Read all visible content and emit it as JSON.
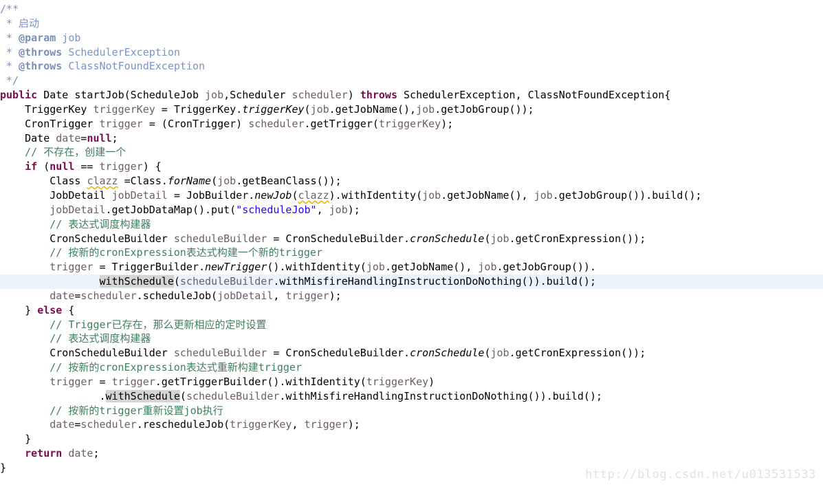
{
  "editor": {
    "language": "java",
    "background": "#ffffff",
    "current_line_highlight_color": "#eaf2fc",
    "occurrence_highlight_color": "#d4d4d4",
    "colors": {
      "keyword": "#7a0d4d",
      "comment": "#3f7f5f",
      "javadoc": "#7a93c4",
      "javadoc_tag": "#7a8fb8",
      "string": "#2a00ff",
      "variable": "#6e5c6b",
      "plain": "#000000",
      "warning_squiggle": "#e8b000"
    },
    "caret_line_index": 20,
    "lines": [
      {
        "i": 0,
        "text": "/**"
      },
      {
        "i": 1,
        "text": " * 启动"
      },
      {
        "i": 2,
        "text": " * @param job"
      },
      {
        "i": 3,
        "text": " * @throws SchedulerException"
      },
      {
        "i": 4,
        "text": " * @throws ClassNotFoundException"
      },
      {
        "i": 5,
        "text": " */"
      },
      {
        "i": 6,
        "text": "public Date startJob(ScheduleJob job,Scheduler scheduler) throws SchedulerException, ClassNotFoundException{"
      },
      {
        "i": 7,
        "text": "    TriggerKey triggerKey = TriggerKey.triggerKey(job.getJobName(),job.getJobGroup());"
      },
      {
        "i": 8,
        "text": "    CronTrigger trigger = (CronTrigger) scheduler.getTrigger(triggerKey);"
      },
      {
        "i": 9,
        "text": "    Date date=null;"
      },
      {
        "i": 10,
        "text": "    // 不存在，创建一个"
      },
      {
        "i": 11,
        "text": "    if (null == trigger) {"
      },
      {
        "i": 12,
        "text": "        Class clazz =Class.forName(job.getBeanClass());"
      },
      {
        "i": 13,
        "text": "        JobDetail jobDetail = JobBuilder.newJob(clazz).withIdentity(job.getJobName(), job.getJobGroup()).build();"
      },
      {
        "i": 14,
        "text": "        jobDetail.getJobDataMap().put(\"scheduleJob\", job);"
      },
      {
        "i": 15,
        "text": "        // 表达式调度构建器"
      },
      {
        "i": 16,
        "text": "        CronScheduleBuilder scheduleBuilder = CronScheduleBuilder.cronSchedule(job.getCronExpression());"
      },
      {
        "i": 17,
        "text": "        // 按新的cronExpression表达式构建一个新的trigger"
      },
      {
        "i": 18,
        "text": "        trigger = TriggerBuilder.newTrigger().withIdentity(job.getJobName(), job.getJobGroup())."
      },
      {
        "i": 19,
        "text": "                withSchedule(scheduleBuilder.withMisfireHandlingInstructionDoNothing()).build();"
      },
      {
        "i": 20,
        "text": "        date=scheduler.scheduleJob(jobDetail, trigger);"
      },
      {
        "i": 21,
        "text": "    } else {"
      },
      {
        "i": 22,
        "text": "        // Trigger已存在，那么更新相应的定时设置"
      },
      {
        "i": 23,
        "text": "        // 表达式调度构建器"
      },
      {
        "i": 24,
        "text": "        CronScheduleBuilder scheduleBuilder = CronScheduleBuilder.cronSchedule(job.getCronExpression());"
      },
      {
        "i": 25,
        "text": "        // 按新的cronExpression表达式重新构建trigger"
      },
      {
        "i": 26,
        "text": "        trigger = trigger.getTriggerBuilder().withIdentity(triggerKey)"
      },
      {
        "i": 27,
        "text": "                .withSchedule(scheduleBuilder.withMisfireHandlingInstructionDoNothing()).build();"
      },
      {
        "i": 28,
        "text": "        // 按新的trigger重新设置job执行"
      },
      {
        "i": 29,
        "text": "        date=scheduler.rescheduleJob(triggerKey, trigger);"
      },
      {
        "i": 30,
        "text": "    }"
      },
      {
        "i": 31,
        "text": "    return date;"
      },
      {
        "i": 32,
        "text": "}"
      }
    ],
    "tokens": {
      "keywords": [
        "public",
        "throws",
        "if",
        "null",
        "else",
        "return"
      ],
      "string_literals": [
        "\"scheduleJob\""
      ],
      "highlighted_identifier": "withSchedule",
      "squiggled_identifier": "clazz"
    }
  },
  "watermark": {
    "text": "http://blog.csdn.net/u013531533"
  }
}
